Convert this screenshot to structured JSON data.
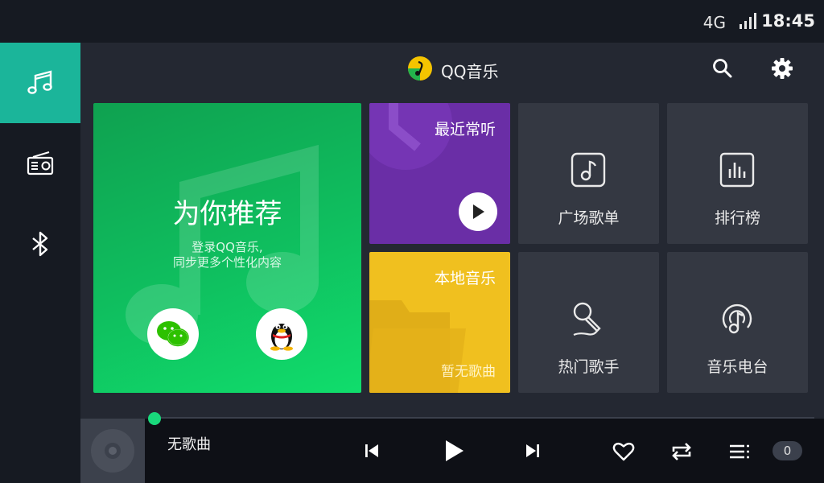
{
  "status": {
    "network": "4G",
    "time": "18:45"
  },
  "header": {
    "title": "QQ音乐"
  },
  "cards": {
    "recommend": {
      "title": "为你推荐",
      "sub_line1": "登录QQ音乐,",
      "sub_line2": "同步更多个性化内容"
    },
    "recent": {
      "title": "最近常听"
    },
    "local": {
      "title": "本地音乐",
      "empty": "暂无歌曲"
    },
    "tiles": [
      {
        "label": "广场歌单",
        "icon": "music-note-square-icon"
      },
      {
        "label": "排行榜",
        "icon": "chart-bars-icon"
      },
      {
        "label": "热门歌手",
        "icon": "microphone-icon"
      },
      {
        "label": "音乐电台",
        "icon": "radio-station-icon"
      }
    ]
  },
  "player": {
    "song": "无歌曲",
    "queue_count": "0",
    "progress": 0
  },
  "colors": {
    "accent": "#1bb59a",
    "recommend": "#0fbf5f",
    "recent": "#6a2ea6",
    "local": "#f0c01f"
  }
}
